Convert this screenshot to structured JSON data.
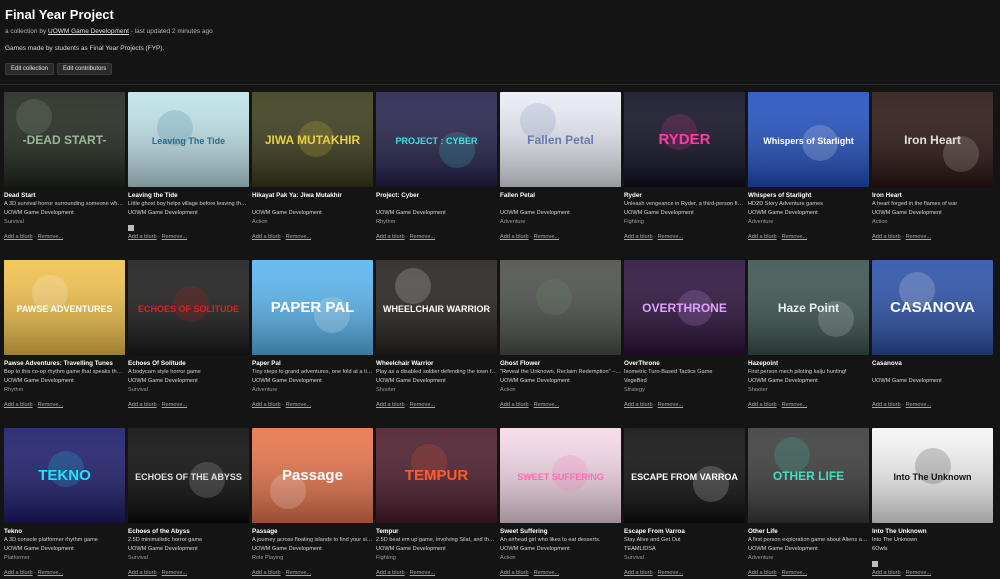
{
  "collection": {
    "title": "Final Year Project",
    "meta_prefix": "a collection by ",
    "owner": "UOWM Game Development",
    "meta_suffix": " - last updated 2 minutes ago",
    "description": "Games made by students as Final Year Projects (FYP).",
    "edit_collection_label": "Edit collection",
    "edit_contributors_label": "Edit contributors"
  },
  "actions": {
    "add_blurb": "Add a blurb",
    "remove": "Remove..."
  },
  "games": [
    {
      "title": "Dead Start",
      "desc": "A 3D survival horror surrounding someone who wakes up",
      "author": "UOWM Game Development",
      "genre": "Survival",
      "platforms": [
        "windows"
      ],
      "thumb_text": "-DEAD START-",
      "bg": "#1f261c"
    },
    {
      "title": "Leaving the Tide",
      "desc": "Little ghost boy helps village before leaving the island",
      "author": "UOWM Game Development",
      "genre": "",
      "platforms": [
        "windows"
      ],
      "thumb_text": "Leaving The Tide",
      "bg": "#bfe3ea"
    },
    {
      "title": "Hikayat Pak Ya: Jiwa Mutakhir",
      "desc": "",
      "author": "UOWM Game Development",
      "genre": "Action",
      "platforms": [],
      "thumb_text": "JIWA MUTAKHIR",
      "bg": "#3a3a1a"
    },
    {
      "title": "Project: Cyber",
      "desc": "",
      "author": "UOWM Game Development",
      "genre": "Rhythm",
      "platforms": [],
      "thumb_text": "PROJECT : CYBER",
      "bg": "#23204a"
    },
    {
      "title": "Fallen Petal",
      "desc": "",
      "author": "UOWM Game Development",
      "genre": "Adventure",
      "platforms": [
        "windows"
      ],
      "thumb_text": "Fallen Petal",
      "bg": "#e8ecf4"
    },
    {
      "title": "Ryder",
      "desc": "Unleash vengeance in Ryder, a third-person fighting game",
      "author": "UOWM Game Development",
      "genre": "Fighting",
      "platforms": [
        "windows"
      ],
      "thumb_text": "RYDER",
      "bg": "#0e0e22"
    },
    {
      "title": "Whispers of Starlight",
      "desc": "HD2D Story Adventure games",
      "author": "UOWM Game Development",
      "genre": "Adventure",
      "platforms": [
        "windows"
      ],
      "thumb_text": "Whispers of Starlight",
      "bg": "#1f4fc0"
    },
    {
      "title": "Iron Heart",
      "desc": "A heart forged in the flames of war",
      "author": "UOWM Game Development",
      "genre": "Action",
      "platforms": [
        "windows"
      ],
      "thumb_text": "Iron Heart",
      "bg": "#2a1410"
    },
    {
      "title": "Pawse Adventures: Travelling Tunes",
      "desc": "Bop to this co-op rhythm game that speaks the language",
      "author": "UOWM Game Development",
      "genre": "Rhythm",
      "platforms": [
        "windows"
      ],
      "thumb_text": "PAWSE ADVENTURES",
      "bg": "#f2c14a"
    },
    {
      "title": "Echoes Of Solitude",
      "desc": "A bodycam style horror game",
      "author": "UOWM Game Development",
      "genre": "Survival",
      "platforms": [],
      "thumb_text": "ECHOES OF SOLITUDE",
      "bg": "#1a1a1a"
    },
    {
      "title": "Paper Pal",
      "desc": "Tiny steps to grand adventures, one fold at a time.",
      "author": "UOWM Game Development",
      "genre": "Adventure",
      "platforms": [
        "windows"
      ],
      "thumb_text": "PAPER PAL",
      "bg": "#58b6f0"
    },
    {
      "title": "Wheelchair Warrior",
      "desc": "Play as a disabled soldier defending the town from zombies",
      "author": "UOWM Game Development",
      "genre": "Shooter",
      "platforms": [],
      "thumb_text": "WHEELCHAIR WARRIOR",
      "bg": "#24201c"
    },
    {
      "title": "Ghost Flower",
      "desc": "\"Reveal the Unknown, Reclaim Redemption\" – An adventure",
      "author": "UOWM Game Development",
      "genre": "Action",
      "platforms": [],
      "thumb_text": "",
      "bg": "#4a4e48"
    },
    {
      "title": "OverThrone",
      "desc": "Isometric Turn-Based Tactics Game",
      "author": "VegeBird",
      "genre": "Strategy",
      "platforms": [
        "windows"
      ],
      "thumb_text": "OVERTHRONE",
      "bg": "#2a0f3a"
    },
    {
      "title": "Hazepoint",
      "desc": "First person mech piloting kaiju hunting!",
      "author": "UOWM Game Development",
      "genre": "Shooter",
      "platforms": [],
      "thumb_text": "Haze Point",
      "bg": "#3a5250"
    },
    {
      "title": "Casanova",
      "desc": "",
      "author": "UOWM Game Development",
      "genre": "",
      "platforms": [],
      "thumb_text": "CASANOVA",
      "bg": "#2a50a8"
    },
    {
      "title": "Tekno",
      "desc": "A 3D console platformer rhythm game",
      "author": "UOWM Game Development",
      "genre": "Platformer",
      "platforms": [
        "windows"
      ],
      "thumb_text": "TEKNO",
      "bg": "#1a1a6a"
    },
    {
      "title": "Echoes of the Abyss",
      "desc": "2.5D minimalistic horror game",
      "author": "UOWM Game Development",
      "genre": "Survival",
      "platforms": [
        "windows",
        "apple"
      ],
      "thumb_text": "ECHOES OF THE ABYSS",
      "bg": "#0a0a0a"
    },
    {
      "title": "Passage",
      "desc": "A journey across floating islands to find your sister",
      "author": "UOWM Game Development",
      "genre": "Role Playing",
      "platforms": [],
      "thumb_text": "Passage",
      "bg": "#e8734a"
    },
    {
      "title": "Tempur",
      "desc": "2.5D beat em up game, involving Silat, and the Malay culture",
      "author": "UOWM Game Development",
      "genre": "Fighting",
      "platforms": [],
      "thumb_text": "TEMPUR",
      "bg": "#4a1a2a"
    },
    {
      "title": "Sweet Suffering",
      "desc": "An airhead girl who likes to eat desserts.",
      "author": "UOWM Game Development",
      "genre": "Action",
      "platforms": [],
      "thumb_text": "SWEET SUFFERING",
      "bg": "#f4d8e8"
    },
    {
      "title": "Escape From Varroa",
      "desc": "Stay Alive and Get Out",
      "author": "TEAMLIDSA",
      "genre": "Survival",
      "platforms": [],
      "thumb_text": "ESCAPE FROM VARROA",
      "bg": "#0e0e0e"
    },
    {
      "title": "Other Life",
      "desc": "A first person exploration game about Aliens and their world",
      "author": "UOWM Game Development",
      "genre": "Adventure",
      "platforms": [],
      "thumb_text": "OTHER LIFE",
      "bg": "#3a3a3a"
    },
    {
      "title": "Into The Unknown",
      "desc": "Into The Unknown",
      "author": "6Owls",
      "genre": "",
      "platforms": [
        "windows"
      ],
      "thumb_text": "Into The Unknown",
      "bg": "#f4f4f4"
    }
  ]
}
